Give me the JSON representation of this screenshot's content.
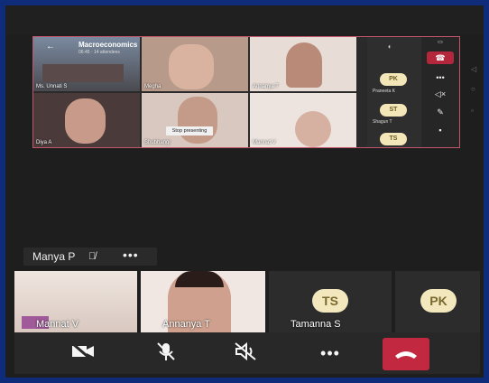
{
  "meeting": {
    "title": "Macroeconomics",
    "subtitle": "06:45 · 14 attendees",
    "stop_presenting": "Stop presenting",
    "shared_tiles": [
      "Ms. Unnati S",
      "Megha",
      "Annanya T",
      "Diya A",
      "Shubhangi",
      "Mannat V"
    ]
  },
  "mini_roster": [
    {
      "initials": "PK",
      "name": "Praneeta K"
    },
    {
      "initials": "ST",
      "name": "Shagun T"
    },
    {
      "initials": "TS",
      "name": ""
    }
  ],
  "active_speaker": {
    "name": "Manya P",
    "more": "•••"
  },
  "participants": [
    {
      "name": "Mannat V",
      "kind": "video"
    },
    {
      "name": "Annanya T",
      "kind": "video"
    },
    {
      "name": "Tamanna S",
      "initials": "TS",
      "kind": "avatar"
    },
    {
      "name": "",
      "initials": "PK",
      "kind": "avatar"
    }
  ],
  "controls": {
    "camera": "camera-off-icon",
    "mic": "mic-off-icon",
    "speaker": "speaker-off-icon",
    "more": "•••",
    "end": "hang-up-icon"
  },
  "colors": {
    "background": "#1e1e1e",
    "border": "#0e2c7a",
    "end_call": "#c2283f",
    "avatar_bg": "#f3e8bd"
  }
}
